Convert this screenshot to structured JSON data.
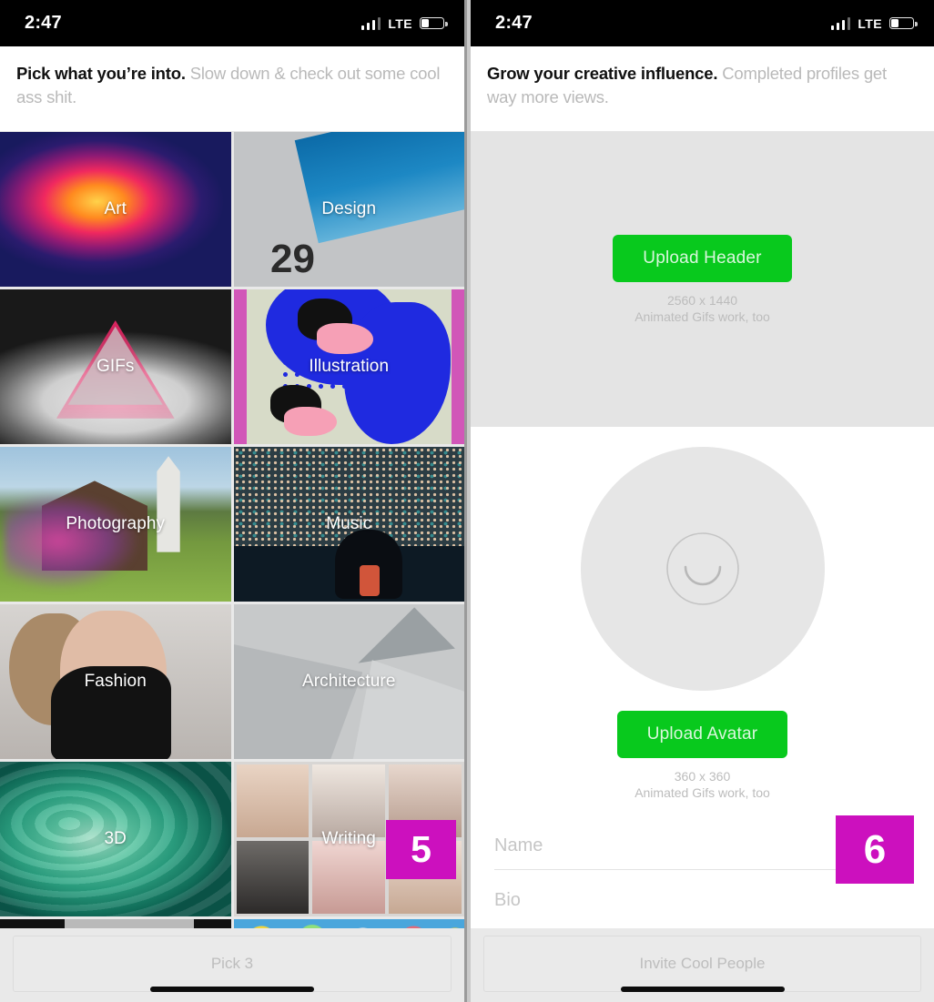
{
  "status_bar": {
    "time": "2:47",
    "network": "LTE",
    "signal_icon": "signal-bars-icon",
    "battery_icon": "battery-low-icon"
  },
  "left_screen": {
    "heading_bold": "Pick what you’re into.",
    "heading_dim": " Slow down & check out some cool ass shit.",
    "tiles": [
      {
        "label": "Art",
        "art": "art-art"
      },
      {
        "label": "Design",
        "art": "art-design"
      },
      {
        "label": "GIFs",
        "art": "art-gifs"
      },
      {
        "label": "Illustration",
        "art": "art-illu"
      },
      {
        "label": "Photography",
        "art": "art-photo"
      },
      {
        "label": "Music",
        "art": "art-music"
      },
      {
        "label": "Fashion",
        "art": "art-fashion"
      },
      {
        "label": "Architecture",
        "art": "art-arch"
      },
      {
        "label": "3D",
        "art": "art-3d"
      },
      {
        "label": "Writing",
        "art": "art-writing"
      }
    ],
    "step_badge": "5",
    "cta_label": "Pick 3"
  },
  "right_screen": {
    "heading_bold": "Grow your creative influence.",
    "heading_dim": " Completed profiles get way more views.",
    "header_upload": {
      "button_label": "Upload Header",
      "dimensions": "2560 x 1440",
      "note": "Animated Gifs work, too"
    },
    "avatar_upload": {
      "placeholder_icon": "smile-face-icon",
      "button_label": "Upload Avatar",
      "dimensions": "360 x 360",
      "note": "Animated Gifs work, too"
    },
    "form": {
      "name_placeholder": "Name",
      "bio_placeholder": "Bio"
    },
    "step_badge": "6",
    "cta_label": "Invite Cool People"
  },
  "colors": {
    "accent_green": "#08c91d",
    "badge_magenta": "#cc10be",
    "heading_bold_text": "#111111",
    "heading_dim_text": "#bcbcbc",
    "status_bar_bg": "#000000",
    "panel_gray": "#e4e4e4"
  }
}
